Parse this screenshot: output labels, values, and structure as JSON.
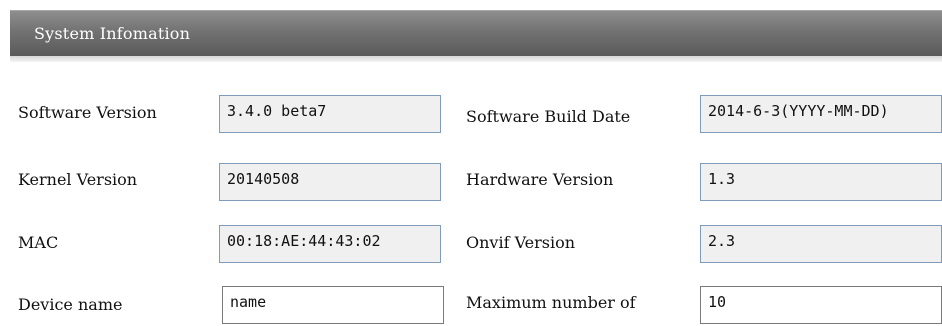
{
  "section_title": "System Infomation",
  "fields": {
    "software_version": {
      "label": "Software Version",
      "value": "3.4.0 beta7"
    },
    "software_build_date": {
      "label": "Software Build Date",
      "value": "2014-6-3(YYYY-MM-DD)"
    },
    "kernel_version": {
      "label": "Kernel Version",
      "value": "20140508"
    },
    "hardware_version": {
      "label": "Hardware Version",
      "value": "1.3"
    },
    "mac": {
      "label": "MAC",
      "value": "00:18:AE:44:43:02"
    },
    "onvif_version": {
      "label": "Onvif Version",
      "value": "2.3"
    },
    "device_name": {
      "label": "Device name",
      "value": "name"
    },
    "maximum_number": {
      "label": "Maximum number  of",
      "value": "10"
    }
  }
}
